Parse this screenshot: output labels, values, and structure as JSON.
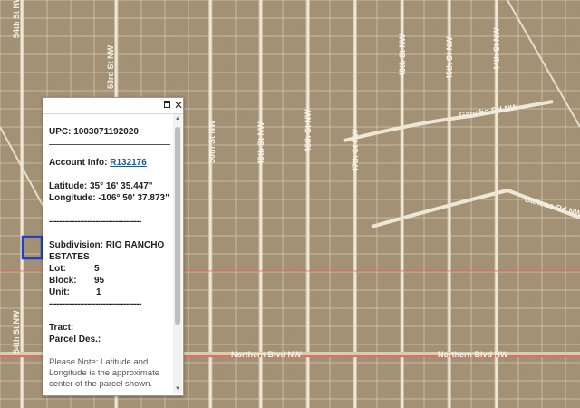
{
  "streets": [
    {
      "name": "54th St NW"
    },
    {
      "name": "53rd St NW"
    },
    {
      "name": "50th St NW"
    },
    {
      "name": "49th St NW"
    },
    {
      "name": "48th St NW"
    },
    {
      "name": "47th St NW"
    },
    {
      "name": "46th St NW"
    },
    {
      "name": "45th St NW"
    },
    {
      "name": "44th St NW"
    },
    {
      "name": "Gancho Rd NW"
    },
    {
      "name": "Gancho Rd NW"
    },
    {
      "name": "Northern Blvd NW"
    },
    {
      "name": "Northern Blvd NW"
    },
    {
      "name": "54th St NW"
    }
  ],
  "colors": {
    "terrain": "#a08c6e",
    "parcel_line": "#e6ddc8",
    "highlight": "#1f3fd6",
    "boundary": "#e64d4d"
  },
  "popup": {
    "upc": "UPC: 1003071192020",
    "account_label": "Account Info:",
    "account_link": "R132176",
    "latitude": "Latitude: 35° 16' 35.447\"",
    "longitude": "Longitude: -106° 50' 37.873\"",
    "separator": "------------------------------------",
    "subdivision": "Subdivision: RIO RANCHO ESTATES",
    "lot_label": "Lot:",
    "lot_value": "5",
    "block_label": "Block:",
    "block_value": "95",
    "unit_label": "Unit:",
    "unit_value": "1",
    "tract": "Tract:",
    "parcel_des": "Parcel Des.:",
    "note": "Please Note: Latitude and Longitude is the approximate center of the parcel shown.",
    "maximize_icon": "maximize-icon",
    "close_icon": "close-icon",
    "close_glyph": "✕"
  }
}
